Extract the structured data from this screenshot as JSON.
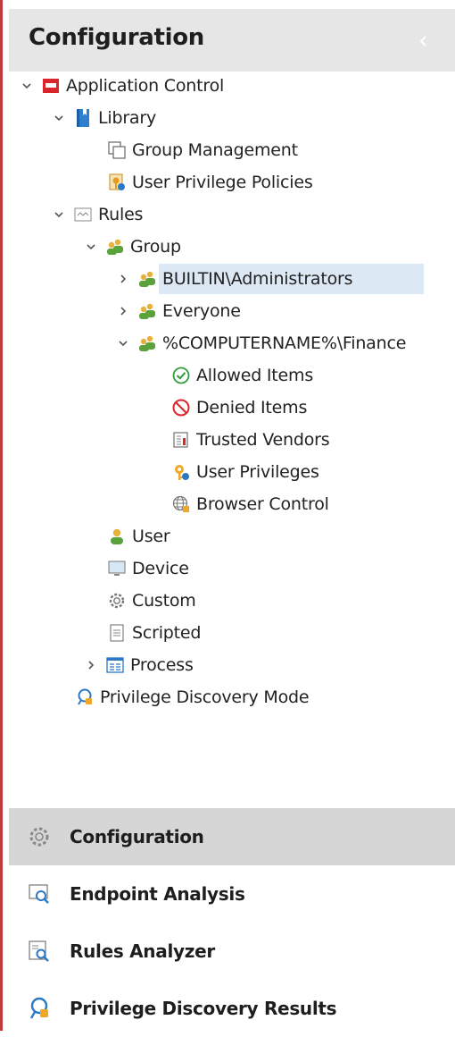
{
  "header": {
    "title": "Configuration"
  },
  "tree": [
    {
      "label": "Application Control",
      "icon": "app-control-icon",
      "expanded": true
    },
    {
      "label": "Library",
      "icon": "library-book-icon",
      "expanded": true
    },
    {
      "label": "Group Management",
      "icon": "group-management-icon"
    },
    {
      "label": "User Privilege Policies",
      "icon": "user-privilege-policy-icon"
    },
    {
      "label": "Rules",
      "icon": "rules-icon",
      "expanded": true
    },
    {
      "label": "Group",
      "icon": "group-users-icon",
      "expanded": true
    },
    {
      "label": "BUILTIN\\Administrators",
      "icon": "group-users-icon",
      "expanded": false,
      "selected": true
    },
    {
      "label": "Everyone",
      "icon": "group-users-icon",
      "expanded": false
    },
    {
      "label": "%COMPUTERNAME%\\Finance",
      "icon": "group-users-icon",
      "expanded": true
    },
    {
      "label": "Allowed Items",
      "icon": "allowed-check-icon"
    },
    {
      "label": "Denied Items",
      "icon": "denied-icon"
    },
    {
      "label": "Trusted Vendors",
      "icon": "trusted-vendors-icon"
    },
    {
      "label": "User Privileges",
      "icon": "user-privileges-key-icon"
    },
    {
      "label": "Browser Control",
      "icon": "browser-globe-icon"
    },
    {
      "label": "User",
      "icon": "user-icon"
    },
    {
      "label": "Device",
      "icon": "device-monitor-icon"
    },
    {
      "label": "Custom",
      "icon": "custom-gear-icon"
    },
    {
      "label": "Scripted",
      "icon": "scripted-document-icon"
    },
    {
      "label": "Process",
      "icon": "process-window-icon",
      "expanded": false
    },
    {
      "label": "Privilege Discovery Mode",
      "icon": "privilege-discovery-icon"
    }
  ],
  "nav": [
    {
      "label": "Configuration",
      "icon": "configuration-gear-icon",
      "active": true
    },
    {
      "label": "Endpoint Analysis",
      "icon": "endpoint-analysis-icon"
    },
    {
      "label": "Rules Analyzer",
      "icon": "rules-analyzer-icon"
    },
    {
      "label": "Privilege Discovery Results",
      "icon": "privilege-discovery-results-icon"
    }
  ],
  "colors": {
    "accent_border": "#c0393b",
    "header_bg": "#e6e6e6",
    "selected_row": "#dce8f4",
    "active_nav": "#d6d6d6"
  }
}
